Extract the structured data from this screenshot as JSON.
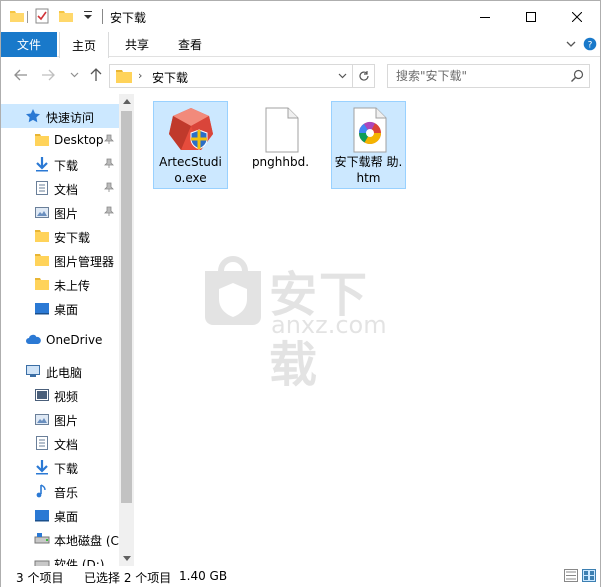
{
  "window": {
    "title": "安下载",
    "controls": [
      "minimize-icon",
      "maximize-icon",
      "close-icon"
    ]
  },
  "ribbon": {
    "file_tab": "文件",
    "tabs": [
      {
        "label": "主页"
      },
      {
        "label": "共享"
      },
      {
        "label": "查看"
      }
    ]
  },
  "address": {
    "path": "安下载",
    "search_placeholder": "搜索\"安下载\""
  },
  "sidebar": {
    "items": [
      {
        "label": "快速访问",
        "icon": "star-icon"
      },
      {
        "label": "Desktop",
        "icon": "folder-icon"
      },
      {
        "label": "下载",
        "icon": "download-arrow-icon"
      },
      {
        "label": "文档",
        "icon": "document-icon"
      },
      {
        "label": "图片",
        "icon": "pictures-icon"
      },
      {
        "label": "安下载",
        "icon": "folder-icon"
      },
      {
        "label": "图片管理器",
        "icon": "folder-icon"
      },
      {
        "label": "未上传",
        "icon": "folder-icon"
      },
      {
        "label": "桌面",
        "icon": "desktop-icon"
      },
      {
        "label": "OneDrive",
        "icon": "cloud-icon"
      },
      {
        "label": "此电脑",
        "icon": "computer-icon"
      },
      {
        "label": "视频",
        "icon": "video-icon"
      },
      {
        "label": "图片",
        "icon": "pictures-icon"
      },
      {
        "label": "文档",
        "icon": "document-icon"
      },
      {
        "label": "下载",
        "icon": "download-arrow-icon"
      },
      {
        "label": "音乐",
        "icon": "music-icon"
      },
      {
        "label": "桌面",
        "icon": "desktop-icon"
      },
      {
        "label": "本地磁盘 (C",
        "icon": "drive-icon"
      },
      {
        "label": "软件 (D:)",
        "icon": "drive-icon"
      }
    ]
  },
  "files": [
    {
      "name": "ArtecStudio.exe",
      "display": "ArtecStudi o.exe",
      "icon": "artec-installer-icon",
      "selected": true
    },
    {
      "name": "pnghhbd.",
      "display": "pnghhbd.",
      "icon": "blank-file-icon",
      "selected": false
    },
    {
      "name": "安下载帮助.htm",
      "display": "安下载帮 助.htm",
      "icon": "chrome-htm-icon",
      "selected": true
    }
  ],
  "watermark": {
    "text": "安下载",
    "sub": "anxz.com"
  },
  "status": {
    "count": "3 个项目",
    "selected": "已选择 2 个项目",
    "size": "1.40 GB"
  },
  "colors": {
    "accent": "#1979ca",
    "selection": "#cce8ff",
    "selection_border": "#99d1ff"
  }
}
